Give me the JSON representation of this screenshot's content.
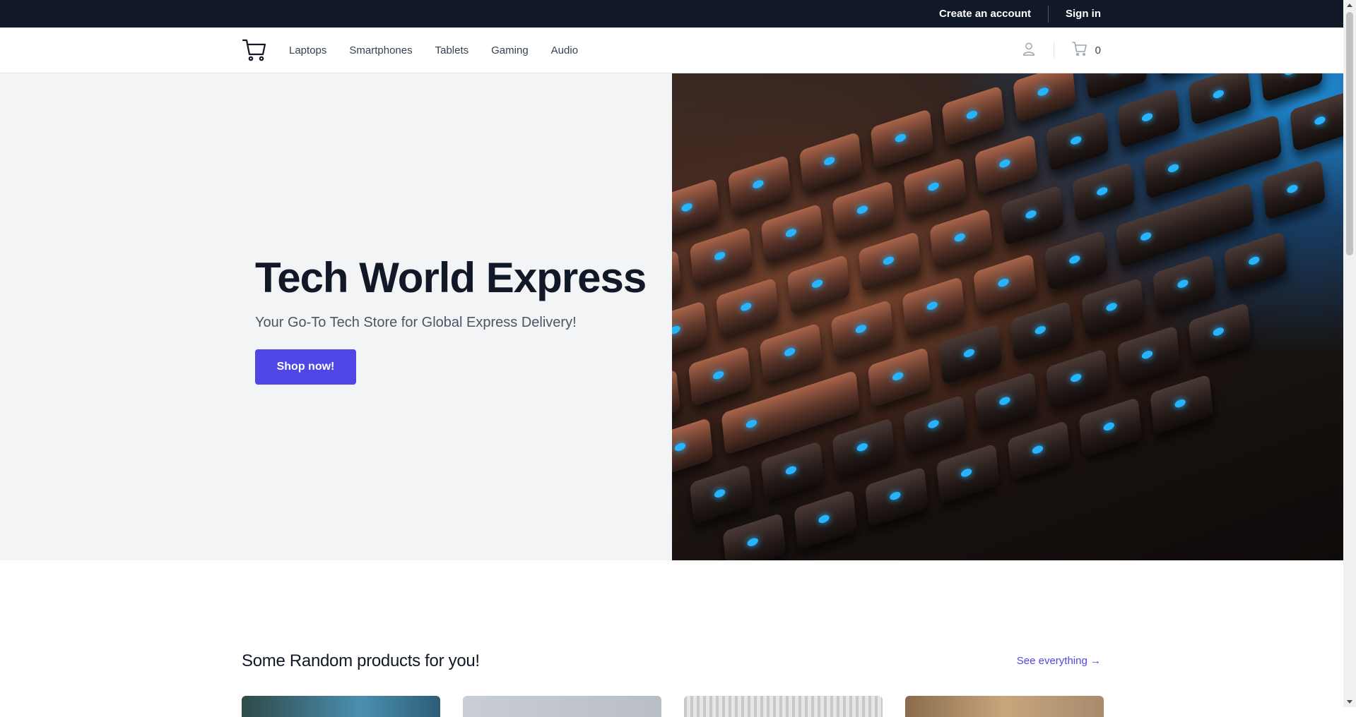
{
  "topbar": {
    "create_account": "Create an account",
    "sign_in": "Sign in"
  },
  "nav": {
    "links": [
      "Laptops",
      "Smartphones",
      "Tablets",
      "Gaming",
      "Audio"
    ],
    "cart_count": "0"
  },
  "hero": {
    "title": "Tech World Express",
    "subtitle": "Your Go-To Tech Store for Global Express Delivery!",
    "cta": "Shop now!"
  },
  "products": {
    "title": "Some Random products for you!",
    "see_all": "See everything →"
  },
  "colors": {
    "topbar_bg": "#111827",
    "accent": "#4f46e5",
    "hero_bg": "#f3f4f6"
  },
  "icons": {
    "logo": "cart-logo-icon",
    "account": "user-icon",
    "cart": "cart-icon"
  }
}
